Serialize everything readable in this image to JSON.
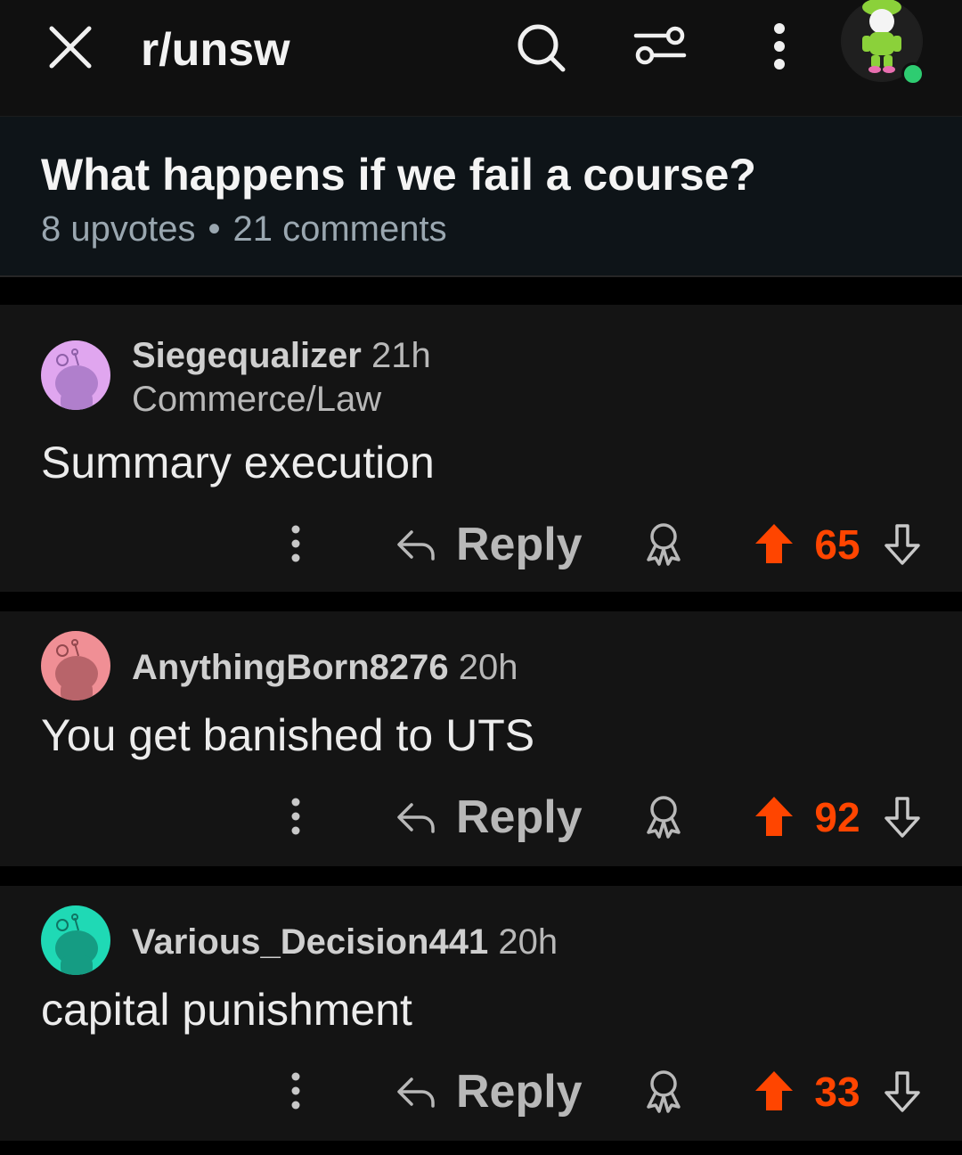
{
  "topbar": {
    "subreddit": "r/unsw",
    "icons": [
      "close-icon",
      "search-icon",
      "filter-icon",
      "more-vertical-icon",
      "user-avatar"
    ],
    "online_status_color": "#2ecc71"
  },
  "post": {
    "title": "What happens if we fail a course?",
    "upvotes": "8 upvotes",
    "separator": "•",
    "comments": "21 comments"
  },
  "comments": [
    {
      "username": "Siegequalizer",
      "time": "21h",
      "flair": "Commerce/Law",
      "body": "Summary execution",
      "reply_label": "Reply",
      "score": "65",
      "avatar_color": "#e0a6ef"
    },
    {
      "username": "AnythingBorn8276",
      "time": "20h",
      "flair": "",
      "body": "You get banished to UTS",
      "reply_label": "Reply",
      "score": "92",
      "avatar_color": "#f08f95"
    },
    {
      "username": "Various_Decision441",
      "time": "20h",
      "flair": "",
      "body": "capital punishment",
      "reply_label": "Reply",
      "score": "33",
      "avatar_color": "#1fd9b5"
    }
  ],
  "colors": {
    "upvote_accent": "#ff4500",
    "background": "#000000",
    "card": "#141414"
  }
}
